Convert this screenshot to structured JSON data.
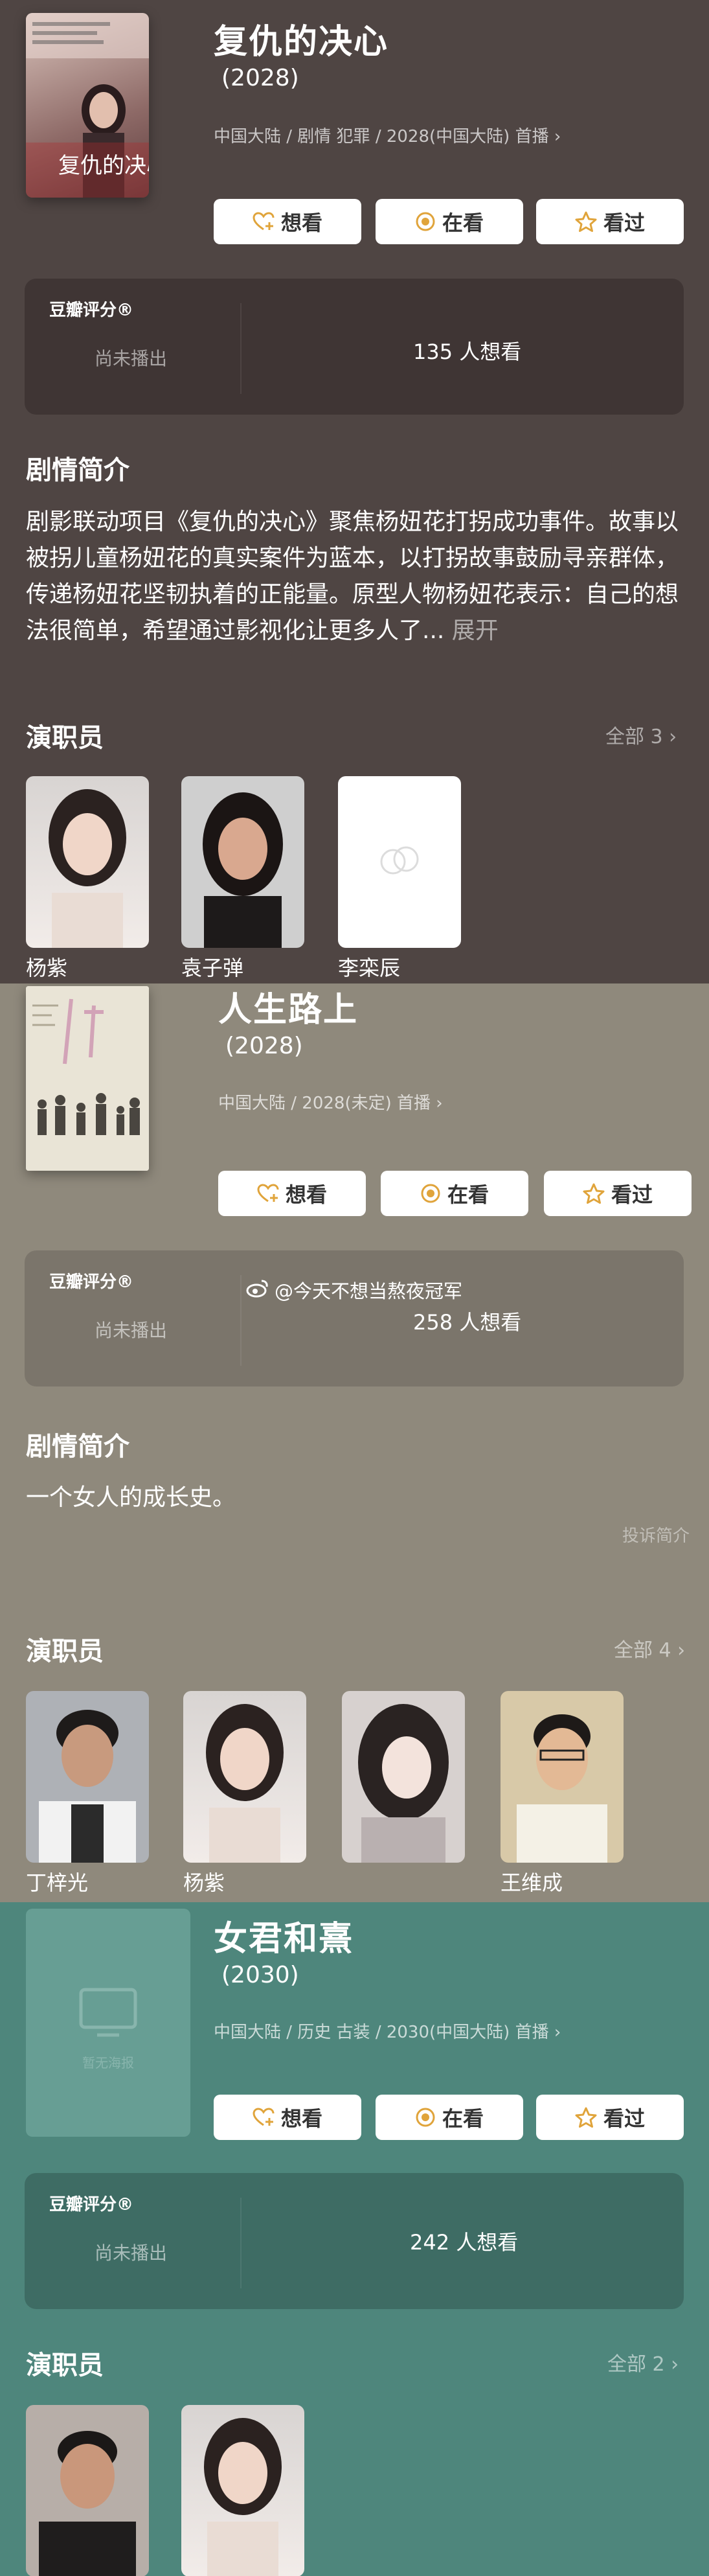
{
  "show1": {
    "title": "复仇的决心",
    "year": "(2028)",
    "meta": "中国大陆 / 剧情 犯罪 / 2028(中国大陆) 首播",
    "poster_text": "复仇的决心",
    "actions": {
      "want": "想看",
      "watching": "在看",
      "watched": "看过"
    },
    "rating_label": "豆瓣评分®",
    "rating_status": "尚未播出",
    "want_count": "135 人想看",
    "synopsis_heading": "剧情简介",
    "synopsis": "剧影联动项目《复仇的决心》聚焦杨妞花打拐成功事件。故事以被拐儿童杨妞花的真实案件为蓝本，以打拐故事鼓励寻亲群体，传递杨妞花坚韧执着的正能量。原型人物杨妞花表示：自己的想法很简单，希望通过影视化让更多人了...",
    "expand": "展开",
    "cast_heading": "演职员",
    "all_cast": "全部 3",
    "cast": [
      "杨紫",
      "袁子弹",
      "李栾辰"
    ]
  },
  "show2": {
    "title": "人生路上",
    "year": "(2028)",
    "meta": "中国大陆 / 2028(未定) 首播",
    "actions": {
      "want": "想看",
      "watching": "在看",
      "watched": "看过"
    },
    "rating_label": "豆瓣评分®",
    "rating_status": "尚未播出",
    "want_count": "258 人想看",
    "watermark": "@今天不想当熬夜冠军",
    "synopsis_heading": "剧情简介",
    "synopsis": "一个女人的成长史。",
    "report": "投诉简介",
    "cast_heading": "演职员",
    "all_cast": "全部 4",
    "cast": [
      "丁梓光",
      "杨紫",
      "",
      "王维成"
    ]
  },
  "show3": {
    "title": "女君和熹",
    "year": "(2030)",
    "meta": "中国大陆 / 历史 古装 / 2030(中国大陆) 首播",
    "poster_placeholder": "暂无海报",
    "actions": {
      "want": "想看",
      "watching": "在看",
      "watched": "看过"
    },
    "rating_label": "豆瓣评分®",
    "rating_status": "尚未播出",
    "want_count": "242 人想看",
    "cast_heading": "演职员",
    "all_cast": "全部 2"
  },
  "colors": {
    "bg1": "#4f4543",
    "bg2": "#8f897c",
    "bg3": "#4e867c",
    "accent": "#e0a43b"
  }
}
